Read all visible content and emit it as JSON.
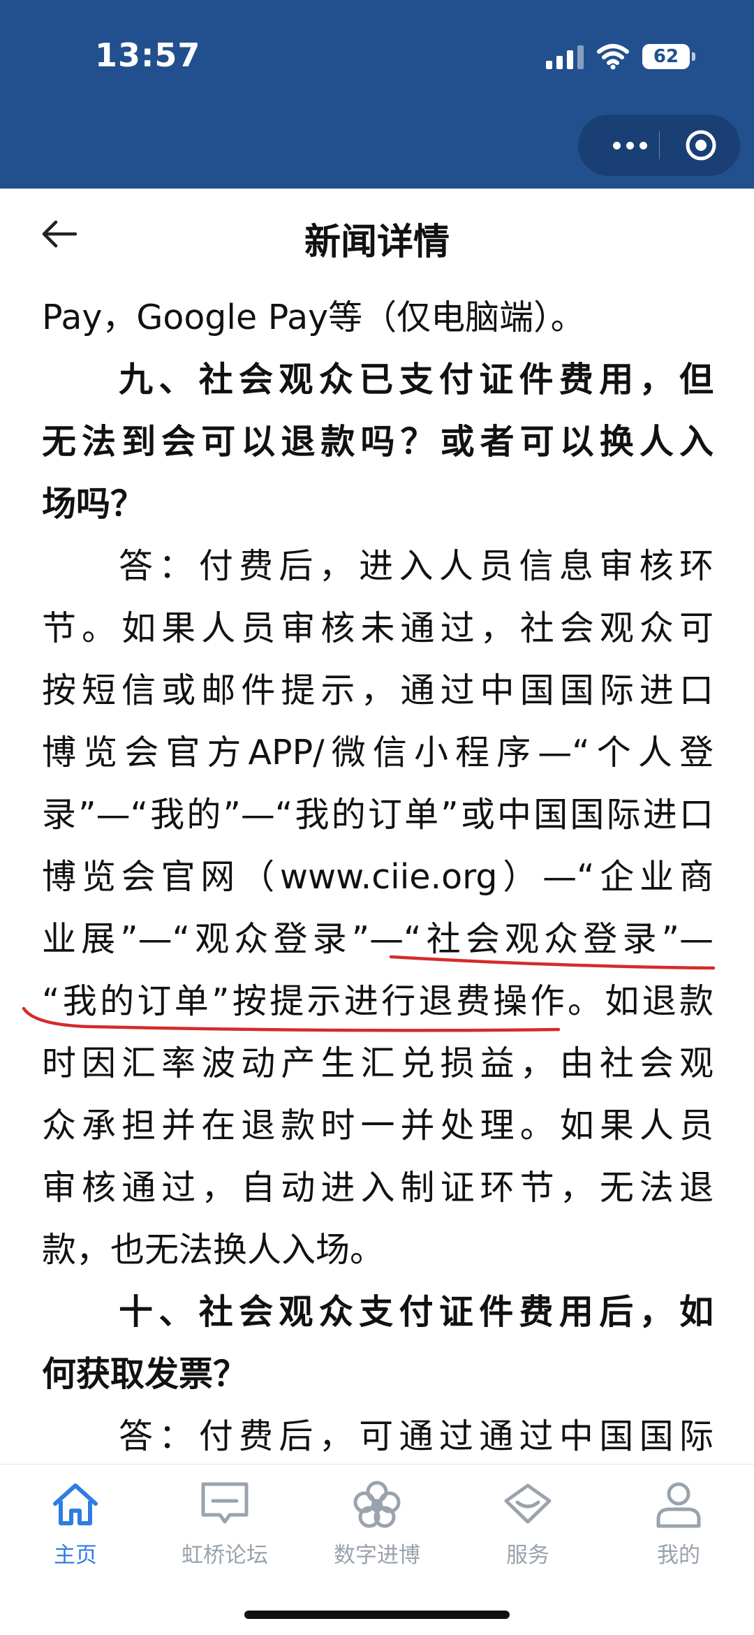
{
  "status_bar": {
    "time": "13:57",
    "battery": "62"
  },
  "nav": {
    "title": "新闻详情"
  },
  "article": {
    "lines": [
      "Pay，Google Pay等（仅电脑端）。",
      "九、社会观众已支付证件费用，但",
      "无法到会可以退款吗？或者可以换人入",
      "场吗？",
      "答：付费后，进入人员信息审核环",
      "节。如果人员审核未通过，社会观众可",
      "按短信或邮件提示，通过中国国际进口",
      "博览会官方APP/微信小程序—“个人登",
      "录”—“我的”—“我的订单”或中国国际进口",
      "博览会官网（www.ciie.org）—“企业商",
      "业展”—“观众登录”—“社会观众登录”—",
      "“我的订单”按提示进行退费操作。如退款",
      "时因汇率波动产生汇兑损益，由社会观",
      "众承担并在退款时一并处理。如果人员",
      "审核通过，自动进入制证环节，无法退",
      "款，也无法换人入场。",
      "十、社会观众支付证件费用后，如",
      "何获取发票？",
      "答：付费后，可通过通过中国国际"
    ]
  },
  "tabs": [
    {
      "label": "主页",
      "icon": "home-icon",
      "active": true
    },
    {
      "label": "虹桥论坛",
      "icon": "forum-chat-icon",
      "active": false
    },
    {
      "label": "数字进博",
      "icon": "flower-icon",
      "active": false
    },
    {
      "label": "服务",
      "icon": "diamond-service-icon",
      "active": false
    },
    {
      "label": "我的",
      "icon": "user-icon",
      "active": false
    }
  ],
  "colors": {
    "header_blue": "#22508f",
    "active_tab": "#2f7de0",
    "inactive_tab": "#9aa3ad",
    "annotation_red": "#d42b2b"
  }
}
